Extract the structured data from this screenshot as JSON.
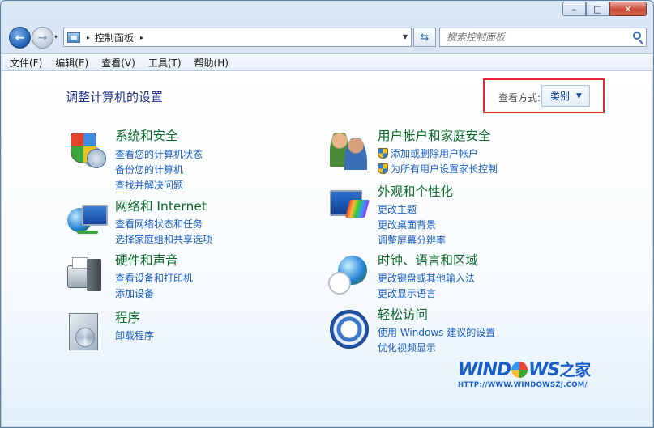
{
  "window": {
    "minimize_glyph": "–",
    "maximize_glyph": "□",
    "close_glyph": "✕"
  },
  "nav": {
    "back_glyph": "←",
    "forward_glyph": "→",
    "dropdown_glyph": "▾",
    "address": {
      "icon": "control-panel-icon",
      "separator": "▸",
      "breadcrumb": "控制面板",
      "trailing_separator": "▸",
      "dropdown_glyph": "▼"
    },
    "refresh_glyph": "⇆",
    "search": {
      "placeholder": "搜索控制面板",
      "icon": "search-icon"
    }
  },
  "menubar": {
    "items": [
      "文件(F)",
      "编辑(E)",
      "查看(V)",
      "工具(T)",
      "帮助(H)"
    ]
  },
  "main": {
    "title": "调整计算机的设置",
    "view_by": {
      "label": "查看方式:",
      "value": "类别",
      "caret": "▼",
      "highlight_color": "#e0282e"
    }
  },
  "categories": [
    {
      "icon": "security-shield-icon",
      "title": "系统和安全",
      "links": [
        "查看您的计算机状态",
        "备份您的计算机",
        "查找并解决问题"
      ]
    },
    {
      "icon": "network-globe-icon",
      "title": "网络和 Internet",
      "links": [
        "查看网络状态和任务",
        "选择家庭组和共享选项"
      ]
    },
    {
      "icon": "printer-hardware-icon",
      "title": "硬件和声音",
      "links": [
        "查看设备和打印机",
        "添加设备"
      ]
    },
    {
      "icon": "programs-icon",
      "title": "程序",
      "links": [
        "卸载程序"
      ]
    },
    {
      "icon": "user-accounts-icon",
      "title": "用户帐户和家庭安全",
      "links": [
        "添加或删除用户帐户",
        "为所有用户设置家长控制"
      ],
      "shield_links": true
    },
    {
      "icon": "appearance-monitor-icon",
      "title": "外观和个性化",
      "links": [
        "更改主题",
        "更改桌面背景",
        "调整屏幕分辨率"
      ]
    },
    {
      "icon": "clock-globe-icon",
      "title": "时钟、语言和区域",
      "links": [
        "更改键盘或其他输入法",
        "更改显示语言"
      ]
    },
    {
      "icon": "ease-of-access-icon",
      "title": "轻松访问",
      "links": [
        "使用 Windows 建议的设置",
        "优化视频显示"
      ]
    }
  ],
  "watermark": {
    "title_latin": "WIND",
    "title_latin2": "WS",
    "title_zh": "之家",
    "url": "HTTP://WWW.WINDOWSZJ.COM/"
  },
  "colors": {
    "link": "#1b5fc1",
    "category_heading": "#0c6b2a",
    "page_title": "#1e3287",
    "brand": "#1a5fc8"
  }
}
